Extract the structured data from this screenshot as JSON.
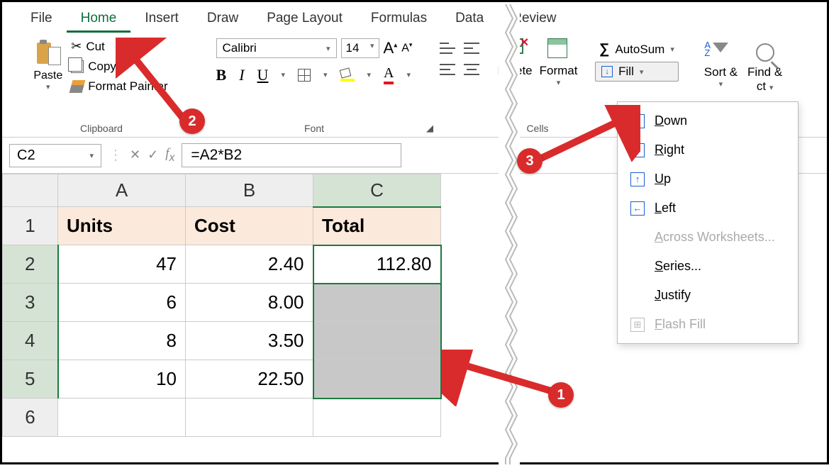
{
  "tabs": {
    "file": "File",
    "home": "Home",
    "insert": "Insert",
    "draw": "Draw",
    "page_layout": "Page Layout",
    "formulas": "Formulas",
    "data": "Data",
    "review": "Review"
  },
  "ribbon": {
    "clipboard": {
      "paste": "Paste",
      "cut": "Cut",
      "copy": "Copy",
      "format_painter": "Format Painter",
      "label": "Clipboard"
    },
    "font": {
      "name": "Calibri",
      "size": "14",
      "label": "Font"
    },
    "cells": {
      "delete": "Delete",
      "format": "Format",
      "label": "Cells"
    },
    "editing": {
      "autosum": "AutoSum",
      "fill": "Fill",
      "sort_filter": "Sort & Filter",
      "find_select": "Find & Select"
    }
  },
  "fill_menu": {
    "down": "Down",
    "right": "Right",
    "up": "Up",
    "left": "Left",
    "across": "Across Worksheets...",
    "series": "Series...",
    "justify": "Justify",
    "flash": "Flash Fill"
  },
  "formula_bar": {
    "name_box": "C2",
    "formula": "=A2*B2"
  },
  "sheet": {
    "col_headers": [
      "A",
      "B",
      "C"
    ],
    "row_headers": [
      "1",
      "2",
      "3",
      "4",
      "5",
      "6"
    ],
    "headers": {
      "a1": "Units",
      "b1": "Cost",
      "c1": "Total"
    },
    "rows": [
      {
        "a": "47",
        "b": "2.40",
        "c": "112.80"
      },
      {
        "a": "6",
        "b": "8.00",
        "c": ""
      },
      {
        "a": "8",
        "b": "3.50",
        "c": ""
      },
      {
        "a": "10",
        "b": "22.50",
        "c": ""
      }
    ]
  },
  "annotations": {
    "b1": "1",
    "b2": "2",
    "b3": "3"
  }
}
